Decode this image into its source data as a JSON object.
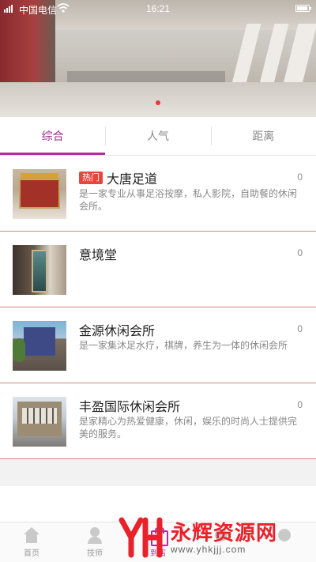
{
  "status_bar": {
    "carrier": "中国电信",
    "time": "16:21"
  },
  "tabs": [
    {
      "label": "综合",
      "active": true
    },
    {
      "label": "人气",
      "active": false
    },
    {
      "label": "距离",
      "active": false
    }
  ],
  "shops": [
    {
      "badge": "热门",
      "name": "大唐足道",
      "count": "0",
      "description": "是一家专业从事足浴按摩，私人影院，自助餐的休闲会所。"
    },
    {
      "badge": "",
      "name": "意境堂",
      "count": "0",
      "description": ""
    },
    {
      "badge": "",
      "name": "金源休闲会所",
      "count": "0",
      "description": "是一家集沐足水疗，棋牌，养生为一体的休闲会所"
    },
    {
      "badge": "",
      "name": "丰盈国际休闲会所",
      "count": "0",
      "description": "是家精心为热爱健康，休闲，娱乐的时尚人士提供完美的服务。"
    }
  ],
  "bottom_nav": [
    {
      "label": "首页",
      "icon": "home-icon"
    },
    {
      "label": "技师",
      "icon": "technician-icon"
    },
    {
      "label": "到店",
      "icon": "shop-icon",
      "active": true
    },
    {
      "label": "",
      "icon": "menu-icon"
    },
    {
      "label": "",
      "icon": "profile-icon"
    }
  ],
  "watermark": {
    "title": "永辉资源网",
    "url": "www.yhkjjj.com"
  },
  "colors": {
    "accent": "#b22e9e",
    "hot_badge": "#e8453c",
    "divider": "#d7867c"
  }
}
